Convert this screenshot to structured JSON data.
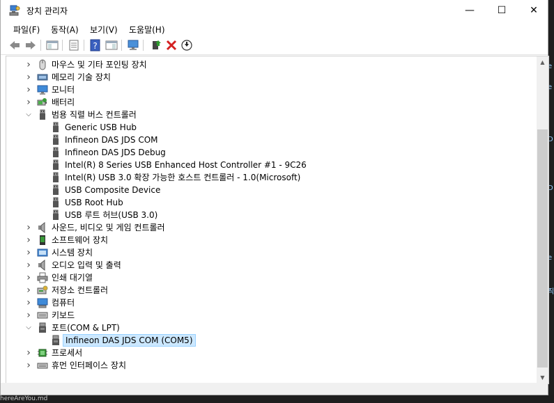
{
  "window": {
    "title": "장치 관리자",
    "minimize": "—",
    "maximize": "☐",
    "close": "✕"
  },
  "menu": {
    "items": [
      "파일(F)",
      "동작(A)",
      "보기(V)",
      "도움말(H)"
    ]
  },
  "toolbar": {
    "icons": [
      "back-icon",
      "forward-icon",
      "show-hide-tree-icon",
      "properties-icon",
      "help-icon",
      "action-pane-icon",
      "monitor-icon",
      "update-driver-icon",
      "uninstall-icon",
      "disable-icon"
    ]
  },
  "tree": {
    "items": [
      {
        "label": "마우스 및 기타 포인팅 장치",
        "expanded": false,
        "level": 0,
        "icon": "mouse-icon"
      },
      {
        "label": "메모리 기술 장치",
        "expanded": false,
        "level": 0,
        "icon": "memory-device-icon"
      },
      {
        "label": "모니터",
        "expanded": false,
        "level": 0,
        "icon": "monitor-icon"
      },
      {
        "label": "배터리",
        "expanded": false,
        "level": 0,
        "icon": "battery-icon"
      },
      {
        "label": "범용 직렬 버스 컨트롤러",
        "expanded": true,
        "level": 0,
        "icon": "usb-icon"
      },
      {
        "label": "Generic USB Hub",
        "level": 1,
        "icon": "usb-icon"
      },
      {
        "label": "Infineon DAS JDS COM",
        "level": 1,
        "icon": "usb-icon"
      },
      {
        "label": "Infineon DAS JDS Debug",
        "level": 1,
        "icon": "usb-icon"
      },
      {
        "label": "Intel(R) 8 Series USB Enhanced Host Controller #1 - 9C26",
        "level": 1,
        "icon": "usb-icon"
      },
      {
        "label": "Intel(R) USB 3.0 확장 가능한 호스트 컨트롤러 - 1.0(Microsoft)",
        "level": 1,
        "icon": "usb-icon"
      },
      {
        "label": "USB Composite Device",
        "level": 1,
        "icon": "usb-icon"
      },
      {
        "label": "USB Root Hub",
        "level": 1,
        "icon": "usb-icon"
      },
      {
        "label": "USB 루트 허브(USB 3.0)",
        "level": 1,
        "icon": "usb-icon"
      },
      {
        "label": "사운드, 비디오 및 게임 컨트롤러",
        "expanded": false,
        "level": 0,
        "icon": "speaker-icon"
      },
      {
        "label": "소프트웨어 장치",
        "expanded": false,
        "level": 0,
        "icon": "software-device-icon"
      },
      {
        "label": "시스템 장치",
        "expanded": false,
        "level": 0,
        "icon": "system-device-icon"
      },
      {
        "label": "오디오 입력 및 출력",
        "expanded": false,
        "level": 0,
        "icon": "speaker-icon"
      },
      {
        "label": "인쇄 대기열",
        "expanded": false,
        "level": 0,
        "icon": "printer-icon"
      },
      {
        "label": "저장소 컨트롤러",
        "expanded": false,
        "level": 0,
        "icon": "storage-controller-icon"
      },
      {
        "label": "컴퓨터",
        "expanded": false,
        "level": 0,
        "icon": "computer-icon"
      },
      {
        "label": "키보드",
        "expanded": false,
        "level": 0,
        "icon": "keyboard-icon"
      },
      {
        "label": "포트(COM & LPT)",
        "expanded": true,
        "level": 0,
        "icon": "port-icon"
      },
      {
        "label": "Infineon DAS JDS COM (COM5)",
        "level": 1,
        "icon": "port-icon",
        "selected": true
      },
      {
        "label": "프로세서",
        "expanded": false,
        "level": 0,
        "icon": "processor-icon"
      },
      {
        "label": "휴먼 인터페이스 장치",
        "expanded": false,
        "level": 0,
        "icon": "hid-icon"
      }
    ]
  },
  "background": {
    "bottom_text": "hereAreYou.md"
  },
  "colors": {
    "selection": "#cce8ff",
    "accent": "#0078d7"
  }
}
